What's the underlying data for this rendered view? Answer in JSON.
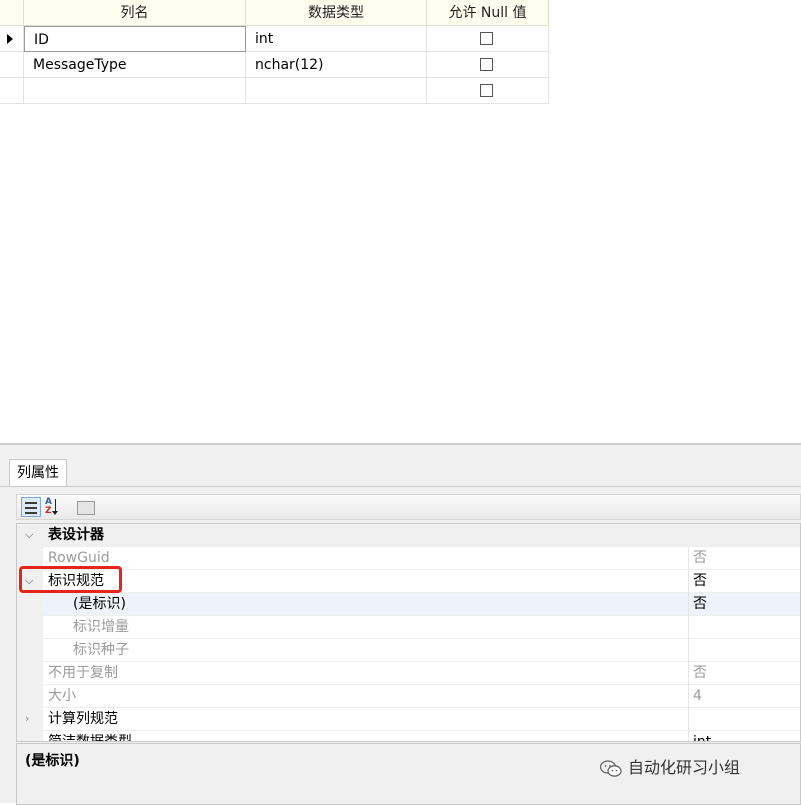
{
  "grid": {
    "headers": [
      "列名",
      "数据类型",
      "允许 Null 值"
    ],
    "rows": [
      {
        "name": "ID",
        "type": "int",
        "allow_null": false
      },
      {
        "name": "MessageType",
        "type": "nchar(12)",
        "allow_null": false
      },
      {
        "name": "",
        "type": "",
        "allow_null": false
      }
    ]
  },
  "panel": {
    "tab_label": "列属性",
    "toolbar": {
      "categorized_icon": "categorized-icon",
      "alphabetical_icon": "sort-az-icon",
      "property_pages_icon": "property-pages-icon"
    },
    "properties": [
      {
        "label": "表设计器",
        "value": ""
      },
      {
        "label": "RowGuid",
        "value": "否"
      },
      {
        "label": "标识规范",
        "value": "否"
      },
      {
        "label": "(是标识)",
        "value": "否"
      },
      {
        "label": "标识增量",
        "value": ""
      },
      {
        "label": "标识种子",
        "value": ""
      },
      {
        "label": "不用于复制",
        "value": "否"
      },
      {
        "label": "大小",
        "value": "4"
      },
      {
        "label": "计算列规范",
        "value": ""
      },
      {
        "label": "简洁数据类型",
        "value": "int"
      }
    ],
    "description_title": "(是标识)"
  },
  "watermark": {
    "text": "自动化研习小组",
    "icon": "wechat-icon"
  },
  "colors": {
    "highlight_box": "#e8231b",
    "header_bg": "#fefef0"
  }
}
